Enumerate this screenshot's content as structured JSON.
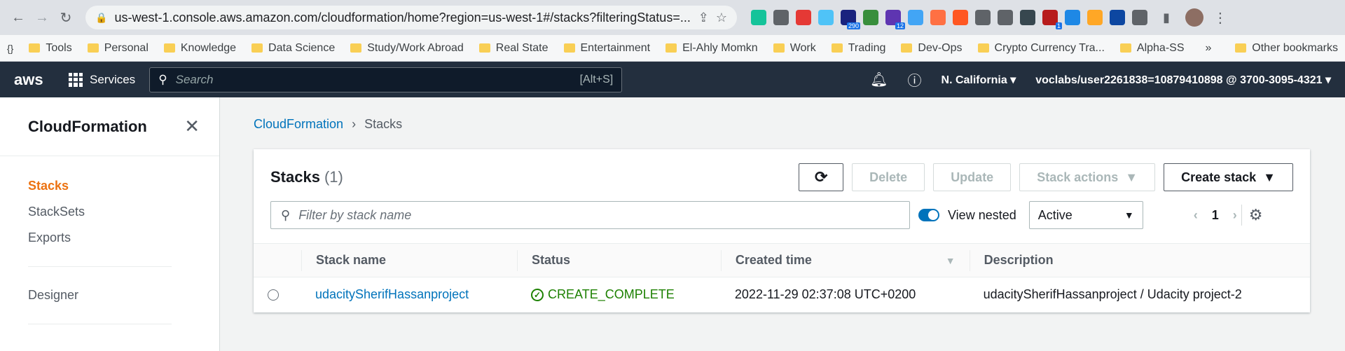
{
  "browser": {
    "url": "us-west-1.console.aws.amazon.com/cloudformation/home?region=us-west-1#/stacks?filteringStatus=...",
    "extensions": [
      {
        "icon": "grammarly-icon",
        "color": "#15c39a",
        "badge": ""
      },
      {
        "icon": "extension-icon-2",
        "color": "#5f6368",
        "badge": ""
      },
      {
        "icon": "extension-icon-3",
        "color": "#e53935",
        "badge": ""
      },
      {
        "icon": "extension-icon-4",
        "color": "#4fc3f7",
        "badge": ""
      },
      {
        "icon": "extension-icon-5",
        "color": "#1a237e",
        "badge": "290"
      },
      {
        "icon": "extension-icon-6",
        "color": "#388e3c",
        "badge": ""
      },
      {
        "icon": "extension-icon-7",
        "color": "#5e35b1",
        "badge": "12"
      },
      {
        "icon": "extension-icon-8",
        "color": "#42a5f5",
        "badge": ""
      },
      {
        "icon": "extension-icon-9",
        "color": "#ff7043",
        "badge": ""
      },
      {
        "icon": "extension-icon-10",
        "color": "#ff5722",
        "badge": ""
      },
      {
        "icon": "extension-icon-11",
        "color": "#5f6368",
        "badge": ""
      },
      {
        "icon": "extension-icon-12",
        "color": "#5f6368",
        "badge": ""
      },
      {
        "icon": "extension-icon-13",
        "color": "#37474f",
        "badge": ""
      },
      {
        "icon": "extension-icon-14",
        "color": "#b71c1c",
        "badge": "1"
      },
      {
        "icon": "extension-icon-15",
        "color": "#1e88e5",
        "badge": ""
      },
      {
        "icon": "extension-icon-16",
        "color": "#ffa726",
        "badge": ""
      },
      {
        "icon": "extension-icon-17",
        "color": "#0d47a1",
        "badge": ""
      },
      {
        "icon": "puzzle-icon",
        "color": "#5f6368",
        "badge": ""
      }
    ]
  },
  "bookmarks": {
    "items": [
      "Tools",
      "Personal",
      "Knowledge",
      "Data Science",
      "Study/Work Abroad",
      "Real State",
      "Entertainment",
      "El-Ahly Momkn",
      "Work",
      "Trading",
      "Dev-Ops",
      "Crypto Currency Tra...",
      "Alpha-SS"
    ],
    "more": "»",
    "other": "Other bookmarks"
  },
  "aws": {
    "logo": "aws",
    "services": "Services",
    "search_placeholder": "Search",
    "search_shortcut": "[Alt+S]",
    "region": "N. California",
    "account": "voclabs/user2261838=10879410898 @ 3700-3095-4321"
  },
  "sidenav": {
    "title": "CloudFormation",
    "items": [
      "Stacks",
      "StackSets",
      "Exports"
    ],
    "designer": "Designer"
  },
  "breadcrumb": {
    "root": "CloudFormation",
    "current": "Stacks"
  },
  "stacks": {
    "title": "Stacks",
    "count": "(1)",
    "delete": "Delete",
    "update": "Update",
    "stack_actions": "Stack actions",
    "create_stack": "Create stack",
    "filter_placeholder": "Filter by stack name",
    "view_nested": "View nested",
    "status_filter": "Active",
    "page": "1",
    "columns": [
      "Stack name",
      "Status",
      "Created time",
      "Description"
    ],
    "rows": [
      {
        "name": "udacitySherifHassanproject",
        "status": "CREATE_COMPLETE",
        "created": "2022-11-29 02:37:08 UTC+0200",
        "description": "udacitySherifHassanproject / Udacity project-2"
      }
    ]
  }
}
